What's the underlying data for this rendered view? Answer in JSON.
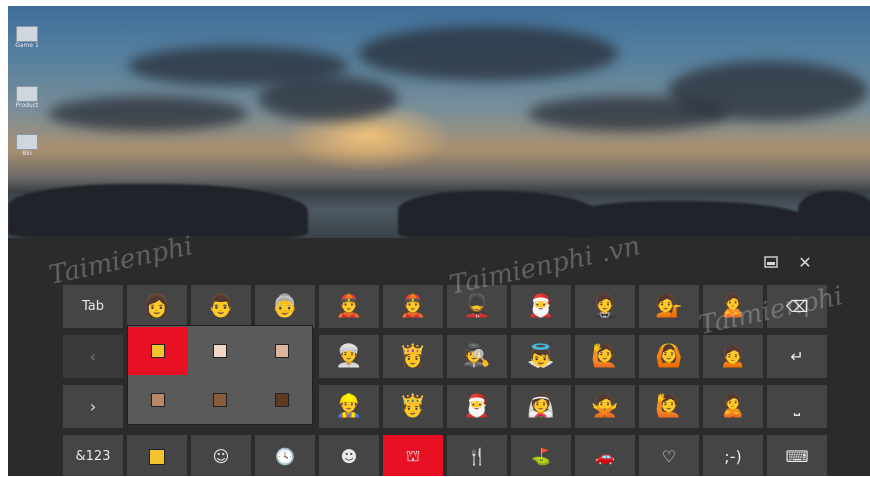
{
  "desktop": {
    "icons": [
      {
        "label": "Game 1"
      },
      {
        "label": "Product"
      },
      {
        "label": "Bin"
      }
    ],
    "watermarks": [
      "Taimienphi",
      "Taimienphi .vn",
      "Taimienphi"
    ]
  },
  "keyboard": {
    "topbar": {
      "dock_icon": "keyboard-dock-icon",
      "close_glyph": "✕"
    },
    "keys": {
      "tab_label": "Tab",
      "num_label": "&123",
      "prev_glyph": "‹",
      "next_glyph": "›",
      "backspace_glyph": "⌫",
      "enter_glyph": "↵",
      "space_glyph": "⎵",
      "keyboard_glyph": "⌨"
    },
    "emoji_rows": [
      [
        "👩",
        "👨",
        "👵",
        "👲",
        "👲",
        "💂",
        "🎅",
        "🤵",
        "💁",
        "🙎"
      ],
      [
        "👳",
        "👸",
        "🕵",
        "👼",
        "🙋",
        "🙆",
        "🙍"
      ],
      [
        "👷",
        "🤴",
        "🎅",
        "👰",
        "🙅",
        "🙋",
        "🙎"
      ]
    ],
    "skin_tones": {
      "colors": [
        "#f4c430",
        "#f2d6c8",
        "#d9b59c",
        "#b98867",
        "#8b5a3c",
        "#5c3a26"
      ],
      "selected_index": 0
    },
    "categories": [
      {
        "name": "skin-tone",
        "glyph": "■",
        "color": "#f4c430"
      },
      {
        "name": "smileys",
        "glyph": "☺"
      },
      {
        "name": "recent",
        "glyph": "🕓"
      },
      {
        "name": "people",
        "glyph": "☻"
      },
      {
        "name": "celebration",
        "glyph": "⛫",
        "active": true
      },
      {
        "name": "food",
        "glyph": "🍴"
      },
      {
        "name": "activity",
        "glyph": "⛳"
      },
      {
        "name": "travel",
        "glyph": "🚗"
      },
      {
        "name": "symbols",
        "glyph": "♡"
      },
      {
        "name": "emoticon",
        "glyph": ";-)"
      }
    ]
  }
}
